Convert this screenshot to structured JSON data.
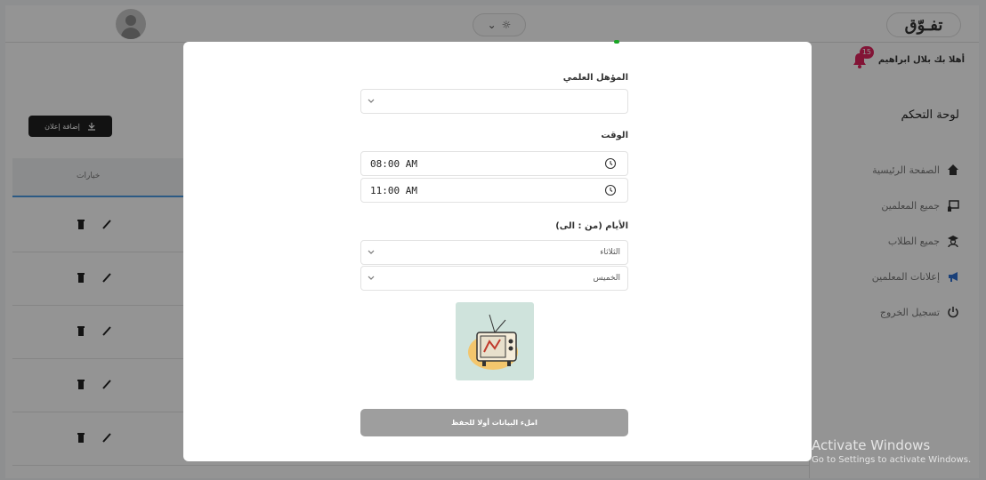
{
  "header": {
    "logo": "تفـوّق",
    "theme_chevron": "⌄",
    "theme_sun": "☼"
  },
  "sidebar": {
    "greeting": "أهلا بك بلال ابراهيم",
    "notifications_count": "15",
    "title": "لوحة التحكم",
    "items": [
      {
        "label": "الصفحة الرئيسية",
        "icon": "home-icon"
      },
      {
        "label": "جميع المعلمين",
        "icon": "teacher-icon"
      },
      {
        "label": "جميع الطلاب",
        "icon": "student-icon"
      },
      {
        "label": "إعلانات المعلمين",
        "icon": "megaphone-icon"
      },
      {
        "label": "تسجيل الخروج",
        "icon": "power-icon"
      }
    ]
  },
  "content": {
    "add_ad_button": "إضافة إعلان",
    "options_header": "خيارات"
  },
  "modal": {
    "qualification_label": "المؤهل العلمي",
    "qualification_value": "",
    "time_label": "الوقت",
    "time_from": "08:00 AM",
    "time_to": "11:00 AM",
    "days_label": "الأيام (من : الى)",
    "day_from": "الثلاثاء",
    "day_to": "الخميس",
    "save_button": "املء البيانات أولا للحفظ"
  },
  "watermark": {
    "title": "Activate Windows",
    "subtitle": "Go to Settings to activate Windows."
  },
  "colors": {
    "accent_green": "#1aa625",
    "badge_red": "#e0245e",
    "button_dark": "#1f1f1f",
    "save_disabled": "#9e9e9e"
  }
}
